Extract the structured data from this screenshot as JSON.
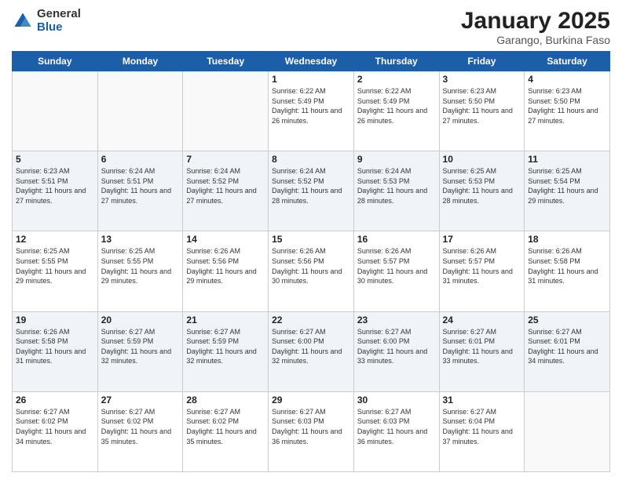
{
  "header": {
    "logo_general": "General",
    "logo_blue": "Blue",
    "title": "January 2025",
    "location": "Garango, Burkina Faso"
  },
  "days_of_week": [
    "Sunday",
    "Monday",
    "Tuesday",
    "Wednesday",
    "Thursday",
    "Friday",
    "Saturday"
  ],
  "weeks": [
    [
      {
        "day": "",
        "info": ""
      },
      {
        "day": "",
        "info": ""
      },
      {
        "day": "",
        "info": ""
      },
      {
        "day": "1",
        "info": "Sunrise: 6:22 AM\nSunset: 5:49 PM\nDaylight: 11 hours and 26 minutes."
      },
      {
        "day": "2",
        "info": "Sunrise: 6:22 AM\nSunset: 5:49 PM\nDaylight: 11 hours and 26 minutes."
      },
      {
        "day": "3",
        "info": "Sunrise: 6:23 AM\nSunset: 5:50 PM\nDaylight: 11 hours and 27 minutes."
      },
      {
        "day": "4",
        "info": "Sunrise: 6:23 AM\nSunset: 5:50 PM\nDaylight: 11 hours and 27 minutes."
      }
    ],
    [
      {
        "day": "5",
        "info": "Sunrise: 6:23 AM\nSunset: 5:51 PM\nDaylight: 11 hours and 27 minutes."
      },
      {
        "day": "6",
        "info": "Sunrise: 6:24 AM\nSunset: 5:51 PM\nDaylight: 11 hours and 27 minutes."
      },
      {
        "day": "7",
        "info": "Sunrise: 6:24 AM\nSunset: 5:52 PM\nDaylight: 11 hours and 27 minutes."
      },
      {
        "day": "8",
        "info": "Sunrise: 6:24 AM\nSunset: 5:52 PM\nDaylight: 11 hours and 28 minutes."
      },
      {
        "day": "9",
        "info": "Sunrise: 6:24 AM\nSunset: 5:53 PM\nDaylight: 11 hours and 28 minutes."
      },
      {
        "day": "10",
        "info": "Sunrise: 6:25 AM\nSunset: 5:53 PM\nDaylight: 11 hours and 28 minutes."
      },
      {
        "day": "11",
        "info": "Sunrise: 6:25 AM\nSunset: 5:54 PM\nDaylight: 11 hours and 29 minutes."
      }
    ],
    [
      {
        "day": "12",
        "info": "Sunrise: 6:25 AM\nSunset: 5:55 PM\nDaylight: 11 hours and 29 minutes."
      },
      {
        "day": "13",
        "info": "Sunrise: 6:25 AM\nSunset: 5:55 PM\nDaylight: 11 hours and 29 minutes."
      },
      {
        "day": "14",
        "info": "Sunrise: 6:26 AM\nSunset: 5:56 PM\nDaylight: 11 hours and 29 minutes."
      },
      {
        "day": "15",
        "info": "Sunrise: 6:26 AM\nSunset: 5:56 PM\nDaylight: 11 hours and 30 minutes."
      },
      {
        "day": "16",
        "info": "Sunrise: 6:26 AM\nSunset: 5:57 PM\nDaylight: 11 hours and 30 minutes."
      },
      {
        "day": "17",
        "info": "Sunrise: 6:26 AM\nSunset: 5:57 PM\nDaylight: 11 hours and 31 minutes."
      },
      {
        "day": "18",
        "info": "Sunrise: 6:26 AM\nSunset: 5:58 PM\nDaylight: 11 hours and 31 minutes."
      }
    ],
    [
      {
        "day": "19",
        "info": "Sunrise: 6:26 AM\nSunset: 5:58 PM\nDaylight: 11 hours and 31 minutes."
      },
      {
        "day": "20",
        "info": "Sunrise: 6:27 AM\nSunset: 5:59 PM\nDaylight: 11 hours and 32 minutes."
      },
      {
        "day": "21",
        "info": "Sunrise: 6:27 AM\nSunset: 5:59 PM\nDaylight: 11 hours and 32 minutes."
      },
      {
        "day": "22",
        "info": "Sunrise: 6:27 AM\nSunset: 6:00 PM\nDaylight: 11 hours and 32 minutes."
      },
      {
        "day": "23",
        "info": "Sunrise: 6:27 AM\nSunset: 6:00 PM\nDaylight: 11 hours and 33 minutes."
      },
      {
        "day": "24",
        "info": "Sunrise: 6:27 AM\nSunset: 6:01 PM\nDaylight: 11 hours and 33 minutes."
      },
      {
        "day": "25",
        "info": "Sunrise: 6:27 AM\nSunset: 6:01 PM\nDaylight: 11 hours and 34 minutes."
      }
    ],
    [
      {
        "day": "26",
        "info": "Sunrise: 6:27 AM\nSunset: 6:02 PM\nDaylight: 11 hours and 34 minutes."
      },
      {
        "day": "27",
        "info": "Sunrise: 6:27 AM\nSunset: 6:02 PM\nDaylight: 11 hours and 35 minutes."
      },
      {
        "day": "28",
        "info": "Sunrise: 6:27 AM\nSunset: 6:02 PM\nDaylight: 11 hours and 35 minutes."
      },
      {
        "day": "29",
        "info": "Sunrise: 6:27 AM\nSunset: 6:03 PM\nDaylight: 11 hours and 36 minutes."
      },
      {
        "day": "30",
        "info": "Sunrise: 6:27 AM\nSunset: 6:03 PM\nDaylight: 11 hours and 36 minutes."
      },
      {
        "day": "31",
        "info": "Sunrise: 6:27 AM\nSunset: 6:04 PM\nDaylight: 11 hours and 37 minutes."
      },
      {
        "day": "",
        "info": ""
      }
    ]
  ]
}
